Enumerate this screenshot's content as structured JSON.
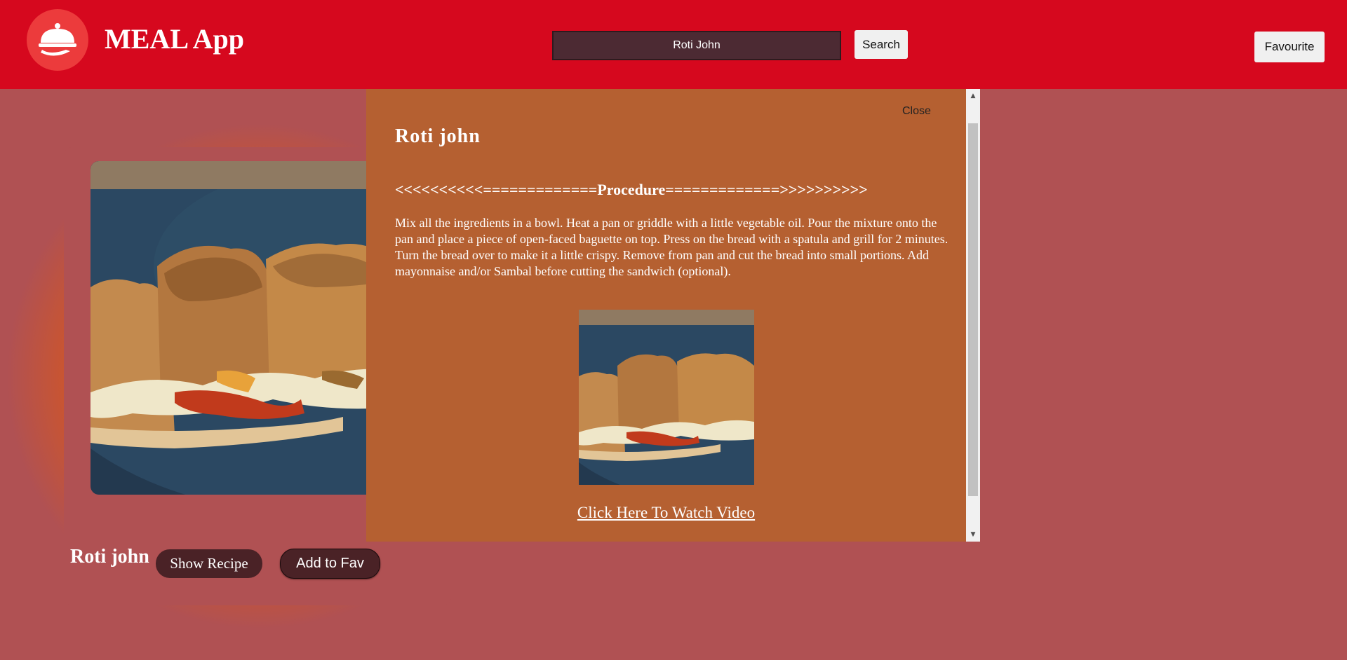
{
  "header": {
    "app_title": "MEAL App",
    "search_value": "Roti John",
    "search_button_label": "Search",
    "favourite_button_label": "Favourite",
    "logo_icon": "cloche-icon",
    "background_color": "#d6081e"
  },
  "card": {
    "title": "Roti john",
    "show_recipe_label": "Show Recipe",
    "add_fav_label": "Add to Fav"
  },
  "modal": {
    "close_label": "Close",
    "title": "Roti john",
    "procedure_heading": "<<<<<<<<<<=============Procedure=============>>>>>>>>>>",
    "instructions": "Mix all the ingredients in a bowl. Heat a pan or griddle with a little vegetable oil. Pour the mixture onto the pan and place a piece of open-faced baguette on top. Press on the bread with a spatula and grill for 2 minutes. Turn the bread over to make it a little crispy. Remove from pan and cut the bread into small portions. Add mayonnaise and/or Sambal before cutting the sandwich (optional).",
    "video_link_label": "Click Here To Watch Video",
    "background_color": "#b56031"
  },
  "page": {
    "background_color": "#b05153",
    "accent_glow_color": "#e25a15"
  }
}
